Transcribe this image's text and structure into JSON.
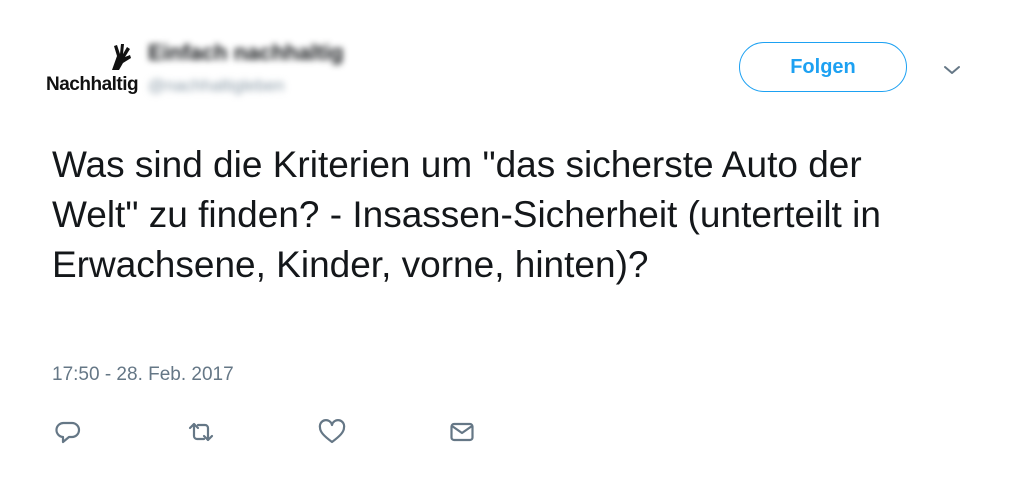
{
  "account": {
    "avatar_text": "Nachhaltig",
    "avatar_icon": "hand-logo-icon",
    "display_name": "Einfach nachhaltig",
    "handle": "@nachhaltigleben"
  },
  "header": {
    "follow_label": "Folgen",
    "more_icon": "chevron-down-icon"
  },
  "tweet": {
    "text": "Was sind die Kriterien um \"das sicherste Auto der Welt\" zu finden? - Insassen-Sicherheit (unterteilt in Erwachsene, Kinder, vorne, hinten)?",
    "timestamp": "17:50 - 28. Feb. 2017"
  },
  "actions": {
    "reply_icon": "reply-icon",
    "retweet_icon": "retweet-icon",
    "like_icon": "heart-icon",
    "dm_icon": "envelope-icon"
  },
  "colors": {
    "accent": "#1da1f2",
    "text": "#14171a",
    "secondary": "#657786",
    "icon": "#657786"
  }
}
